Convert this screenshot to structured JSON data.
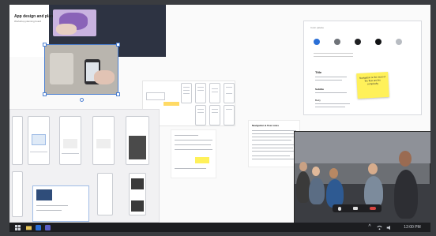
{
  "board": {
    "title_card": {
      "title": "App design and planning",
      "subtitle": "Workshop planning board"
    },
    "brand_colors": {
      "accent_blue": "#2b6fd6",
      "sticky_yellow": "#fff15a",
      "taskbar": "#1c1d20"
    },
    "style_panel": {
      "header": "Color palette",
      "swatches": [
        "#2b6fd6",
        "#6f7379",
        "#1f2023",
        "#111214",
        "#b8bcc2"
      ],
      "sections": [
        "Title",
        "Subtitle",
        "Body"
      ]
    },
    "sticky_note": {
      "text": "Navigation is the most of the flow and its complexity"
    },
    "document": {
      "title": "Navigation & flow notes"
    },
    "video_call": {
      "controls": [
        "mic-icon",
        "camera-icon",
        "end-call-icon"
      ]
    }
  },
  "taskbar": {
    "start_icon": "windows-icon",
    "pinned": [
      "file-explorer-icon",
      "whiteboard-icon",
      "teams-icon"
    ],
    "tray": [
      "chevron-up-icon",
      "wifi-icon",
      "volume-icon"
    ],
    "clock": "12:00 PM"
  }
}
